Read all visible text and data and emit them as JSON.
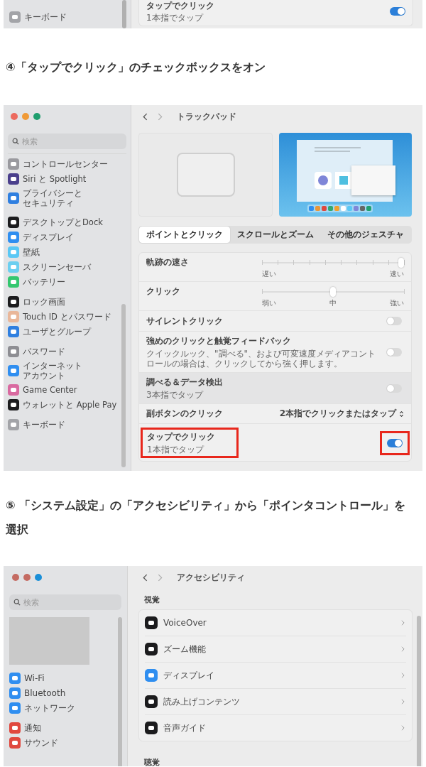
{
  "top_screenshot": {
    "sidebar_items": [
      {
        "label": "キーボード",
        "color": "#a3a4a8"
      }
    ],
    "rows": [
      {
        "kind": "toggle",
        "label": "タップでクリック",
        "description": "1本指でタップ",
        "on": true,
        "shaded": false,
        "annotated": false
      }
    ]
  },
  "step4_heading": "④「タップでクリック」のチェックボックスをオン",
  "trackpad_screenshot": {
    "window_buttons": [
      {
        "color": "#ec6a5e"
      },
      {
        "color": "#f09a37"
      },
      {
        "color": "#1f9e6e"
      }
    ],
    "search": {
      "placeholder": "検索"
    },
    "sidebar_groups": [
      {
        "items": [
          {
            "label": "コントロールセンター",
            "color": "#9a9a9f"
          },
          {
            "label": "Siri と Spotlight",
            "color": "#4a3f8c"
          },
          {
            "lines": [
              "プライバシーと",
              "セキュリティ"
            ],
            "color": "#2f7fe0"
          }
        ]
      },
      {
        "items": [
          {
            "label": "デスクトップとDock",
            "color": "#1c1c1e"
          },
          {
            "label": "ディスプレイ",
            "color": "#2f8ef0"
          },
          {
            "label": "壁紙",
            "color": "#5ac8f5"
          },
          {
            "label": "スクリーンセーバ",
            "color": "#6ccff0"
          },
          {
            "label": "バッテリー",
            "color": "#34c76f"
          }
        ]
      },
      {
        "items": [
          {
            "label": "ロック画面",
            "color": "#1c1c1e"
          },
          {
            "label": "Touch ID とパスワード",
            "color": "#e9b79a"
          },
          {
            "label": "ユーザとグループ",
            "color": "#2f7fe0"
          }
        ]
      },
      {
        "items": [
          {
            "label": "パスワード",
            "color": "#8e8e93"
          },
          {
            "lines": [
              "インターネット",
              "アカウント"
            ],
            "color": "#2f8ef0"
          },
          {
            "label": "Game Center",
            "color": "#d96aa0"
          },
          {
            "label": "ウォレットと Apple Pay",
            "color": "#1c1c1e"
          }
        ]
      },
      {
        "items": [
          {
            "label": "キーボード",
            "color": "#a3a4a8"
          }
        ]
      }
    ],
    "title": "トラックパッド",
    "tabs": [
      {
        "label": "ポイントとクリック",
        "selected": true
      },
      {
        "label": "スクロールとズーム",
        "selected": false
      },
      {
        "label": "その他のジェスチャ",
        "selected": false
      }
    ],
    "rows": [
      {
        "kind": "slider",
        "label": "軌跡の速さ",
        "level": 1,
        "stepped": true,
        "scale_labels": [
          "遅い",
          "速い"
        ]
      },
      {
        "kind": "slider",
        "label": "クリック",
        "level": 0.5,
        "stepped": false,
        "scale_labels": [
          "弱い",
          "中",
          "強い"
        ]
      },
      {
        "kind": "toggle",
        "label": "サイレントクリック",
        "on": false,
        "shaded": false,
        "annotated": false
      },
      {
        "kind": "toggle",
        "label": "強めのクリックと触覚フィードバック",
        "description": "クイックルック、\"調べる\"、および可変速度メディアコントロールの場合は、クリックしてから強く押します。",
        "on": false,
        "shaded": false,
        "annotated": false
      },
      {
        "kind": "toggle",
        "label": "調べる＆データ検出",
        "description": "3本指でタップ",
        "on": false,
        "shaded": true,
        "annotated": false
      },
      {
        "kind": "select",
        "label": "副ボタンのクリック",
        "value": "2本指でクリックまたはタップ"
      },
      {
        "kind": "toggle",
        "label": "タップでクリック",
        "description": "1本指でタップ",
        "on": true,
        "shaded": false,
        "annotated": true
      }
    ]
  },
  "step5_heading": "⑤ 「システム設定」の「アクセシビリティ」から「ポインタコントロール」を選択",
  "accessibility_screenshot": {
    "window_buttons": [
      {
        "color": "#c46b62"
      },
      {
        "color": "#c46b62"
      },
      {
        "color": "#1a8fd8"
      }
    ],
    "search": {
      "placeholder": "検索"
    },
    "sidebar_groups": [
      {
        "items": [
          {
            "label": "Wi-Fi",
            "color": "#2f8ef0"
          },
          {
            "label": "Bluetooth",
            "color": "#2f8ef0"
          },
          {
            "label": "ネットワーク",
            "color": "#2f8ef0"
          }
        ]
      },
      {
        "items": [
          {
            "label": "通知",
            "color": "#e0483e"
          },
          {
            "label": "サウンド",
            "color": "#e0483e"
          }
        ]
      }
    ],
    "title": "アクセシビリティ",
    "sections": [
      {
        "heading": "視覚",
        "items": [
          {
            "label": "VoiceOver",
            "color": "#1c1c1e"
          },
          {
            "label": "ズーム機能",
            "color": "#1c1c1e"
          },
          {
            "label": "ディスプレイ",
            "color": "#2f8ef0"
          },
          {
            "label": "読み上げコンテンツ",
            "color": "#1c1c1e"
          },
          {
            "label": "音声ガイド",
            "color": "#1c1c1e"
          }
        ]
      },
      {
        "heading": "聴覚"
      }
    ]
  }
}
